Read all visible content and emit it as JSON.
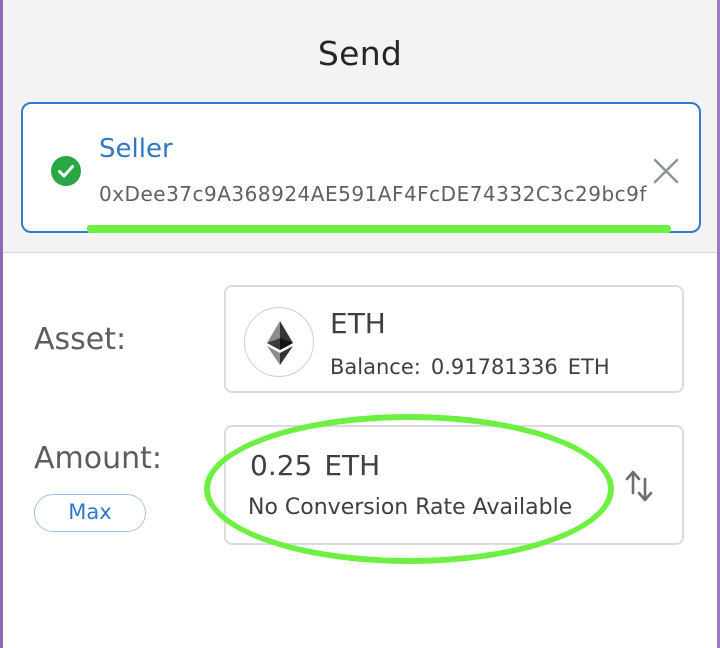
{
  "header": {
    "title": "Send"
  },
  "recipient": {
    "name": "Seller",
    "address": "0xDee37c9A368924AE591AF4FcDE74332C3c29bc9f"
  },
  "asset": {
    "label": "Asset:",
    "symbol": "ETH",
    "balance_label": "Balance:",
    "balance_value": "0.91781336",
    "balance_unit": "ETH",
    "icon": "ethereum-icon"
  },
  "amount": {
    "label": "Amount:",
    "value": "0.25",
    "unit": "ETH",
    "conversion": "No Conversion Rate Available",
    "max_label": "Max"
  },
  "colors": {
    "accent_blue": "#2f78c5",
    "success_green": "#28a745",
    "highlight_green": "#6ef042"
  }
}
